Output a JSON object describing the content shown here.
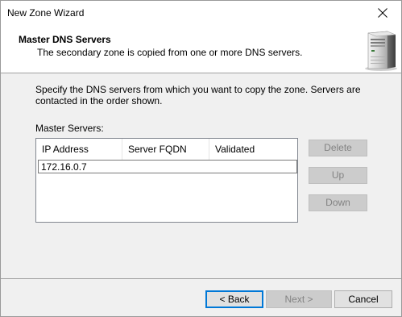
{
  "window": {
    "title": "New Zone Wizard"
  },
  "header": {
    "title": "Master DNS Servers",
    "subtitle": "The secondary zone is copied from one or more DNS servers.",
    "icon": "server-icon"
  },
  "body": {
    "instructions": "Specify the DNS servers from which you want to copy the zone.  Servers are contacted in the order shown.",
    "master_label": "Master Servers:"
  },
  "list": {
    "columns": [
      "IP Address",
      "Server FQDN",
      "Validated"
    ],
    "edit_value": "172.16.0.7"
  },
  "side_buttons": {
    "delete": "Delete",
    "up": "Up",
    "down": "Down"
  },
  "footer": {
    "back": "< Back",
    "next": "Next >",
    "cancel": "Cancel"
  },
  "colors": {
    "focus_border": "#0078d7",
    "disabled_text": "#838383"
  }
}
